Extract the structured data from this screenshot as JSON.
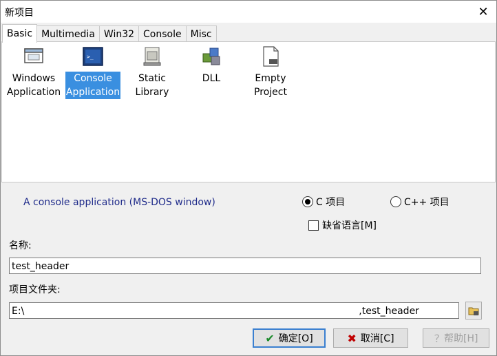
{
  "window": {
    "title": "新项目"
  },
  "tabs": [
    "Basic",
    "Multimedia",
    "Win32",
    "Console",
    "Misc"
  ],
  "projects": [
    {
      "line1": "Windows",
      "line2": "Application",
      "icon": "window-icon"
    },
    {
      "line1": "Console",
      "line2": "Application",
      "icon": "console-icon"
    },
    {
      "line1": "Static",
      "line2": "Library",
      "icon": "library-icon"
    },
    {
      "line1": "DLL",
      "line2": "",
      "icon": "puzzle-icon"
    },
    {
      "line1": "Empty",
      "line2": "Project",
      "icon": "empty-project-icon"
    }
  ],
  "description": "A console application (MS-DOS window)",
  "language": {
    "c_label": "C 项目",
    "cpp_label": "C++ 项目",
    "selected": "C"
  },
  "default_lang_label": "缺省语言[M]",
  "name": {
    "label": "名称:",
    "value": "test_header"
  },
  "folder": {
    "label": "项目文件夹:",
    "value_start": "E:\\",
    "value_end": "test_header"
  },
  "buttons": {
    "ok": "确定[O]",
    "cancel": "取消[C]",
    "help": "帮助[H]"
  },
  "colors": {
    "selection": "#3a8fe0",
    "description_text": "#1f2b8a",
    "ok_check": "#1a8a2a",
    "cancel_x": "#c00000"
  }
}
